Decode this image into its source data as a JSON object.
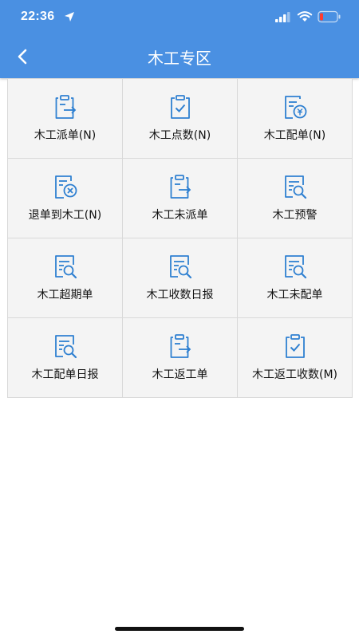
{
  "status_bar": {
    "time": "22:36"
  },
  "header": {
    "title": "木工专区",
    "back_icon": "chevron-left-icon"
  },
  "colors": {
    "header_bg": "#4a90e2",
    "icon_blue": "#2f80d1",
    "cell_bg": "#f4f4f4",
    "grid_line": "#d9d9d9"
  },
  "menu": [
    {
      "label": "木工派单(N)",
      "icon": "clipboard-arrow-icon"
    },
    {
      "label": "木工点数(N)",
      "icon": "clipboard-check-icon"
    },
    {
      "label": "木工配单(N)",
      "icon": "document-coin-icon"
    },
    {
      "label": "退单到木工(N)",
      "icon": "document-cancel-icon"
    },
    {
      "label": "木工未派单",
      "icon": "clipboard-arrow-icon"
    },
    {
      "label": "木工预警",
      "icon": "document-search-icon"
    },
    {
      "label": "木工超期单",
      "icon": "document-search-icon"
    },
    {
      "label": "木工收数日报",
      "icon": "document-search-icon"
    },
    {
      "label": "木工未配单",
      "icon": "document-search-icon"
    },
    {
      "label": "木工配单日报",
      "icon": "document-search-icon"
    },
    {
      "label": "木工返工单",
      "icon": "clipboard-arrow-icon"
    },
    {
      "label": "木工返工收数(M)",
      "icon": "clipboard-check-icon"
    }
  ]
}
